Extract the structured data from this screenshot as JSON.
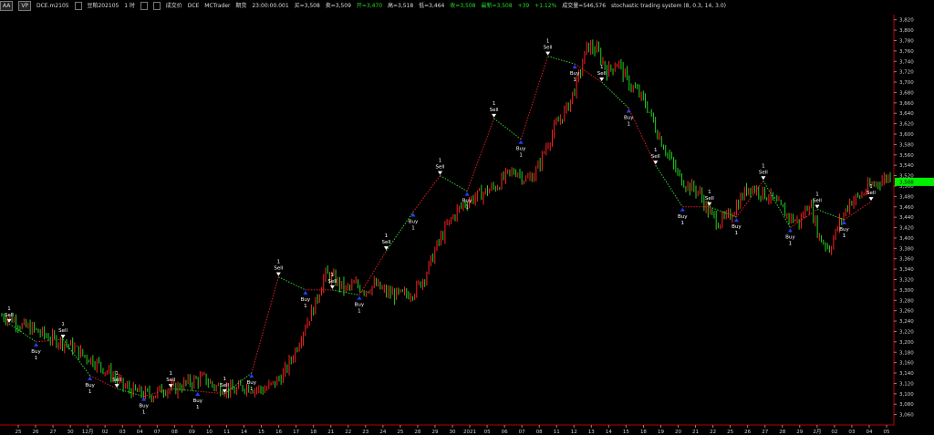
{
  "header": {
    "btn1": "AA",
    "btn2": "VP",
    "symbol": "DCE.m2105",
    "name": "豆粕202105",
    "interval": "1 时",
    "b3": "",
    "extra1": "成交价",
    "exch": "DCE",
    "vendor": "MCTrader",
    "mode": "期货",
    "time": "23:00:00.001",
    "bid": "买=3,508",
    "ask": "卖=3,509",
    "open": "开=3,470",
    "high": "高=3,518",
    "low": "低=3,464",
    "close": "收=3,508",
    "last": "最新=3,508",
    "chg": "+39",
    "pct": "+1.12%",
    "volume": "成交量=546,576",
    "strategy": "stochastic trading system (8,  0.3,  14,  3.0)"
  },
  "colors": {
    "up": "#ff2020",
    "down": "#20d020",
    "buy": "#2040ff",
    "sell": "#ffffff",
    "axis": "#c00000",
    "price_tag": "#00ee00"
  },
  "chart_data": {
    "type": "candlestick",
    "ylim": [
      3040,
      3830
    ],
    "y_ticks": [
      3060,
      3080,
      3100,
      3120,
      3140,
      3160,
      3180,
      3200,
      3220,
      3240,
      3260,
      3280,
      3300,
      3320,
      3340,
      3360,
      3380,
      3400,
      3420,
      3440,
      3460,
      3480,
      3500,
      3520,
      3540,
      3560,
      3580,
      3600,
      3620,
      3640,
      3660,
      3680,
      3700,
      3720,
      3740,
      3760,
      3780,
      3800,
      3820
    ],
    "y_tick_labels": [
      "3,060",
      "3,080",
      "3,100",
      "3,120",
      "3,140",
      "3,160",
      "3,180",
      "3,200",
      "3,220",
      "3,240",
      "3,260",
      "3,280",
      "3,300",
      "3,320",
      "3,340",
      "3,360",
      "3,380",
      "3,400",
      "3,420",
      "3,440",
      "3,460",
      "3,480",
      "3,500",
      "3,520",
      "3,540",
      "3,560",
      "3,580",
      "3,600",
      "3,620",
      "3,640",
      "3,660",
      "3,680",
      "3,700",
      "3,720",
      "3,740",
      "3,760",
      "3,780",
      "3,800",
      "3,820"
    ],
    "x_tick_labels": [
      "25",
      "26",
      "27",
      "30",
      "12月",
      "02",
      "03",
      "04",
      "07",
      "08",
      "09",
      "10",
      "11",
      "14",
      "15",
      "16",
      "17",
      "18",
      "21",
      "22",
      "23",
      "24",
      "25",
      "28",
      "29",
      "30",
      "2021",
      "05",
      "06",
      "07",
      "08",
      "11",
      "12",
      "13",
      "14",
      "15",
      "18",
      "19",
      "20",
      "21",
      "22",
      "25",
      "26",
      "27",
      "28",
      "29",
      "2月",
      "02",
      "03",
      "04",
      "05"
    ],
    "close_path": [
      3250,
      3245,
      3230,
      3225,
      3215,
      3205,
      3200,
      3190,
      3175,
      3165,
      3150,
      3135,
      3115,
      3105,
      3100,
      3098,
      3110,
      3108,
      3118,
      3125,
      3130,
      3115,
      3110,
      3105,
      3115,
      3110,
      3108,
      3120,
      3140,
      3180,
      3230,
      3270,
      3330,
      3320,
      3300,
      3310,
      3300,
      3310,
      3295,
      3290,
      3290,
      3300,
      3330,
      3380,
      3420,
      3450,
      3470,
      3480,
      3490,
      3500,
      3520,
      3530,
      3510,
      3530,
      3580,
      3620,
      3650,
      3700,
      3770,
      3760,
      3720,
      3740,
      3700,
      3680,
      3650,
      3600,
      3560,
      3520,
      3500,
      3490,
      3450,
      3430,
      3440,
      3470,
      3500,
      3490,
      3480,
      3460,
      3440,
      3430,
      3470,
      3400,
      3380,
      3430,
      3470,
      3480,
      3500,
      3510,
      3520
    ],
    "trades": [
      {
        "type": "sell",
        "label": "Sell",
        "qty": "1",
        "price": 3235
      },
      {
        "type": "buy",
        "label": "Buy",
        "qty": "1",
        "price": 3200
      },
      {
        "type": "sell",
        "label": "Sell",
        "qty": "1",
        "price": 3205
      },
      {
        "type": "buy",
        "label": "Buy",
        "qty": "1",
        "price": 3135
      },
      {
        "type": "sell",
        "label": "Sell",
        "qty": "1",
        "price": 3110
      },
      {
        "type": "buy",
        "label": "Buy",
        "qty": "1",
        "price": 3095
      },
      {
        "type": "sell",
        "label": "Sell",
        "qty": "1",
        "price": 3110
      },
      {
        "type": "buy",
        "label": "Buy",
        "qty": "1",
        "price": 3105
      },
      {
        "type": "sell",
        "label": "Sell",
        "qty": "1",
        "price": 3100
      },
      {
        "type": "buy",
        "label": "Buy",
        "qty": "1",
        "price": 3140
      },
      {
        "type": "sell",
        "label": "Sell",
        "qty": "1",
        "price": 3325
      },
      {
        "type": "buy",
        "label": "Buy",
        "qty": "1",
        "price": 3300
      },
      {
        "type": "sell",
        "label": "Sell",
        "qty": "1",
        "price": 3300
      },
      {
        "type": "buy",
        "label": "Buy",
        "qty": "1",
        "price": 3290
      },
      {
        "type": "sell",
        "label": "Sell",
        "qty": "1",
        "price": 3375
      },
      {
        "type": "buy",
        "label": "Buy",
        "qty": "1",
        "price": 3450
      },
      {
        "type": "sell",
        "label": "Sell",
        "qty": "1",
        "price": 3520
      },
      {
        "type": "buy",
        "label": "Buy",
        "qty": "1",
        "price": 3490
      },
      {
        "type": "sell",
        "label": "Sell",
        "qty": "1",
        "price": 3630
      },
      {
        "type": "buy",
        "label": "Buy",
        "qty": "1",
        "price": 3590
      },
      {
        "type": "sell",
        "label": "Sell",
        "qty": "1",
        "price": 3750
      },
      {
        "type": "buy",
        "label": "Buy",
        "qty": "1",
        "price": 3735
      },
      {
        "type": "sell",
        "label": "Sell",
        "qty": "1",
        "price": 3700
      },
      {
        "type": "buy",
        "label": "Buy",
        "qty": "1",
        "price": 3650
      },
      {
        "type": "sell",
        "label": "Sell",
        "qty": "1",
        "price": 3540
      },
      {
        "type": "buy",
        "label": "Buy",
        "qty": "1",
        "price": 3460
      },
      {
        "type": "sell",
        "label": "Sell",
        "qty": "1",
        "price": 3460
      },
      {
        "type": "buy",
        "label": "Buy",
        "qty": "1",
        "price": 3440
      },
      {
        "type": "sell",
        "label": "Sell",
        "qty": "1",
        "price": 3510
      },
      {
        "type": "buy",
        "label": "Buy",
        "qty": "1",
        "price": 3420
      },
      {
        "type": "sell",
        "label": "Sell",
        "qty": "1",
        "price": 3455
      },
      {
        "type": "buy",
        "label": "Buy",
        "qty": "1",
        "price": 3435
      },
      {
        "type": "sell",
        "label": "Sell",
        "qty": "1",
        "price": 3470
      }
    ],
    "current_price_label": "3,508",
    "current_price": 3508
  }
}
